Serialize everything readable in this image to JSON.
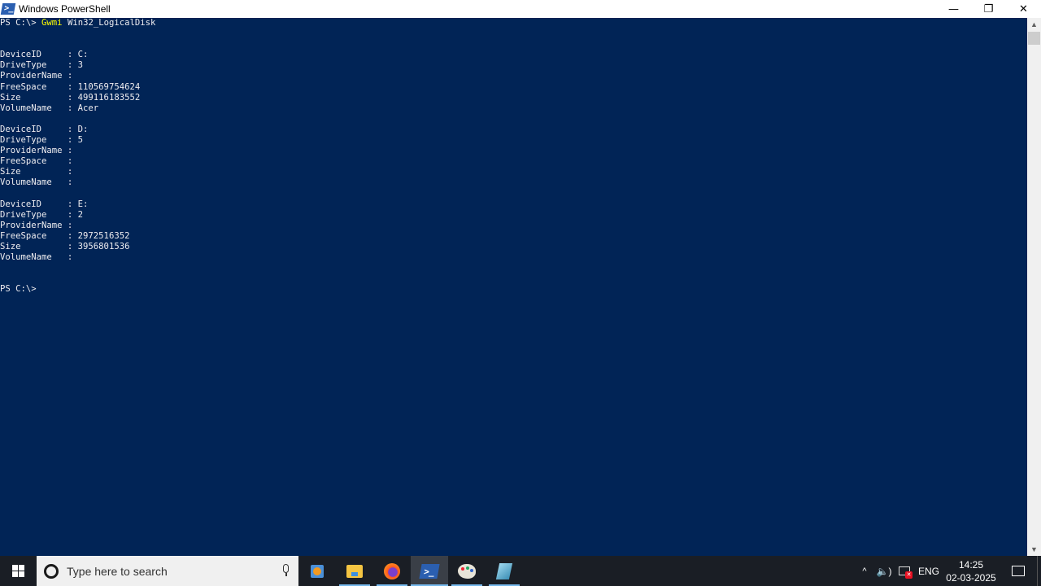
{
  "window": {
    "title": "Windows PowerShell",
    "controls": {
      "minimize": "—",
      "restore": "❐",
      "close": "✕"
    }
  },
  "console": {
    "prompt": "PS C:\\>",
    "command_verb": "Gwmi",
    "command_args": "Win32_LogicalDisk",
    "disks": [
      {
        "DeviceID": "C:",
        "DriveType": "3",
        "ProviderName": "",
        "FreeSpace": "110569754624",
        "Size": "499116183552",
        "VolumeName": "Acer"
      },
      {
        "DeviceID": "D:",
        "DriveType": "5",
        "ProviderName": "",
        "FreeSpace": "",
        "Size": "",
        "VolumeName": ""
      },
      {
        "DeviceID": "E:",
        "DriveType": "2",
        "ProviderName": "",
        "FreeSpace": "2972516352",
        "Size": "3956801536",
        "VolumeName": ""
      }
    ],
    "field_labels": [
      "DeviceID",
      "DriveType",
      "ProviderName",
      "FreeSpace",
      "Size",
      "VolumeName"
    ],
    "final_prompt": "PS C:\\>"
  },
  "scrollbar": {
    "up_arrow": "▲",
    "down_arrow": "▼"
  },
  "taskbar": {
    "search_placeholder": "Type here to search",
    "apps": [
      {
        "name": "media-player",
        "active": false
      },
      {
        "name": "file-explorer",
        "active": false
      },
      {
        "name": "firefox",
        "active": false
      },
      {
        "name": "powershell",
        "active": true
      },
      {
        "name": "paint",
        "active": false
      },
      {
        "name": "notepad",
        "active": false
      }
    ],
    "tray": {
      "chevron": "^",
      "volume": "🔈)",
      "language": "ENG",
      "time": "14:25",
      "date": "02-03-2025"
    }
  },
  "colors": {
    "console_bg": "#012456",
    "console_fg": "#eeedf0",
    "command_highlight": "#ffff00",
    "taskbar_bg": "#1a1e25",
    "accent": "#76b9ed"
  }
}
